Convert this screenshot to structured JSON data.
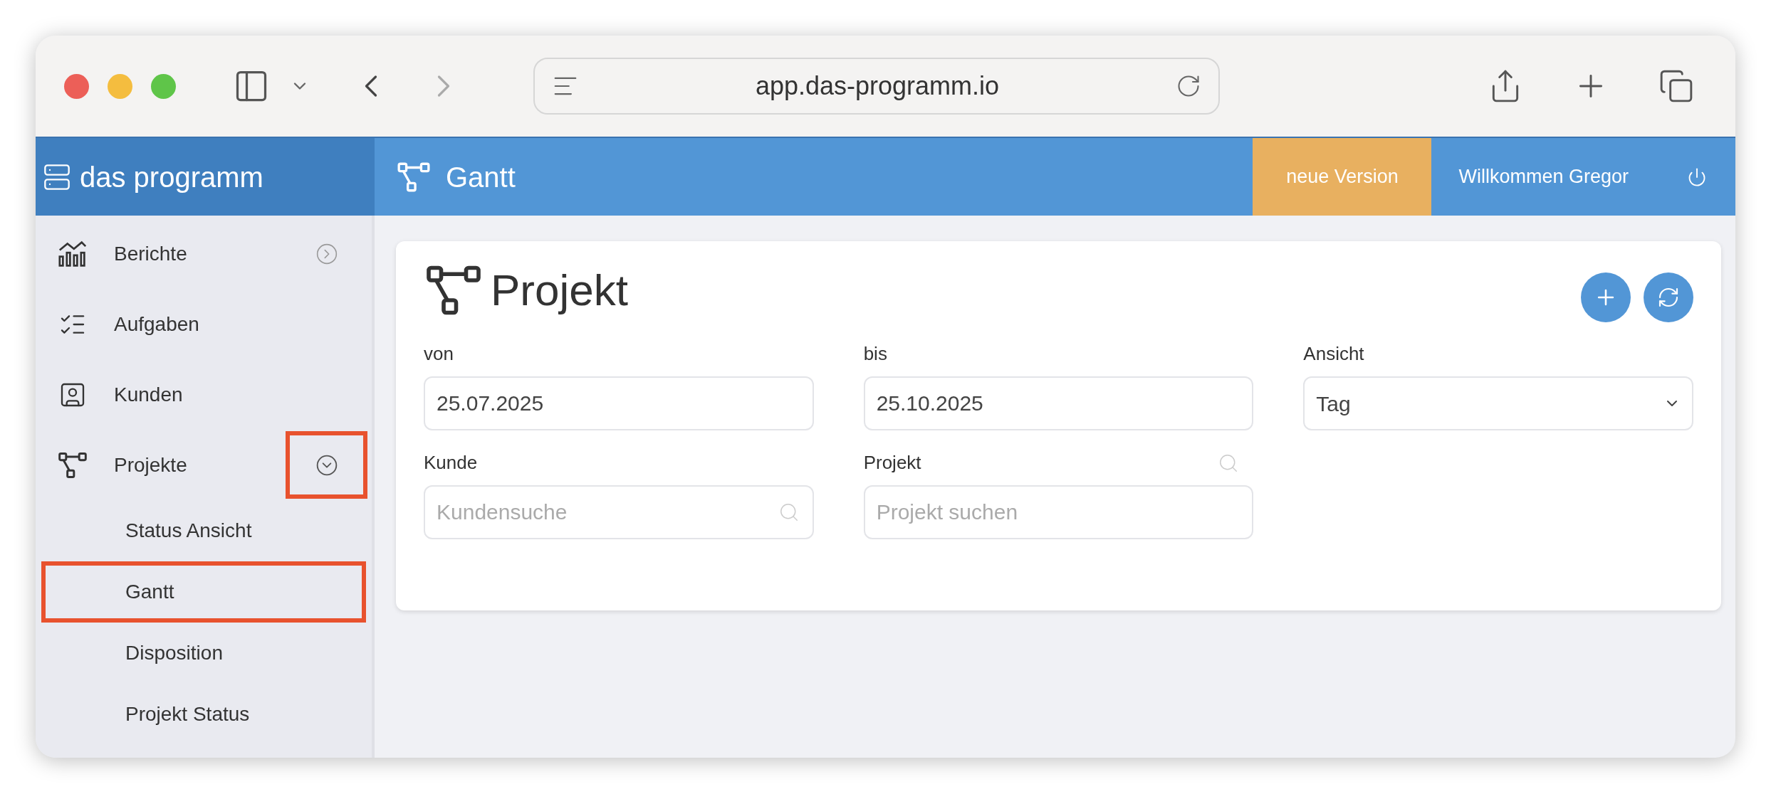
{
  "browser": {
    "url": "app.das-programm.io"
  },
  "header": {
    "brand": "das programm",
    "page_title": "Gantt",
    "version_button": "neue Version",
    "welcome": "Willkommen Gregor"
  },
  "sidebar": {
    "items": [
      {
        "label": "Berichte",
        "kind": "group",
        "expanded": false,
        "highlighted": false
      },
      {
        "label": "Aufgaben",
        "kind": "link"
      },
      {
        "label": "Kunden",
        "kind": "link"
      },
      {
        "label": "Projekte",
        "kind": "group",
        "expanded": true,
        "highlighted": true,
        "children": [
          {
            "label": "Status Ansicht",
            "highlighted": false
          },
          {
            "label": "Gantt",
            "highlighted": true
          },
          {
            "label": "Disposition",
            "highlighted": false
          },
          {
            "label": "Projekt Status",
            "highlighted": false
          }
        ]
      }
    ]
  },
  "panel": {
    "title": "Projekt",
    "fields": [
      {
        "label": "von",
        "kind": "text",
        "value": "25.07.2025"
      },
      {
        "label": "bis",
        "kind": "text",
        "value": "25.10.2025"
      },
      {
        "label": "Ansicht",
        "kind": "select",
        "value": "Tag"
      },
      {
        "label": "Kunde",
        "kind": "search",
        "placeholder": "Kundensuche"
      },
      {
        "label": "Projekt",
        "kind": "search_above",
        "placeholder": "Projekt suchen"
      }
    ]
  }
}
